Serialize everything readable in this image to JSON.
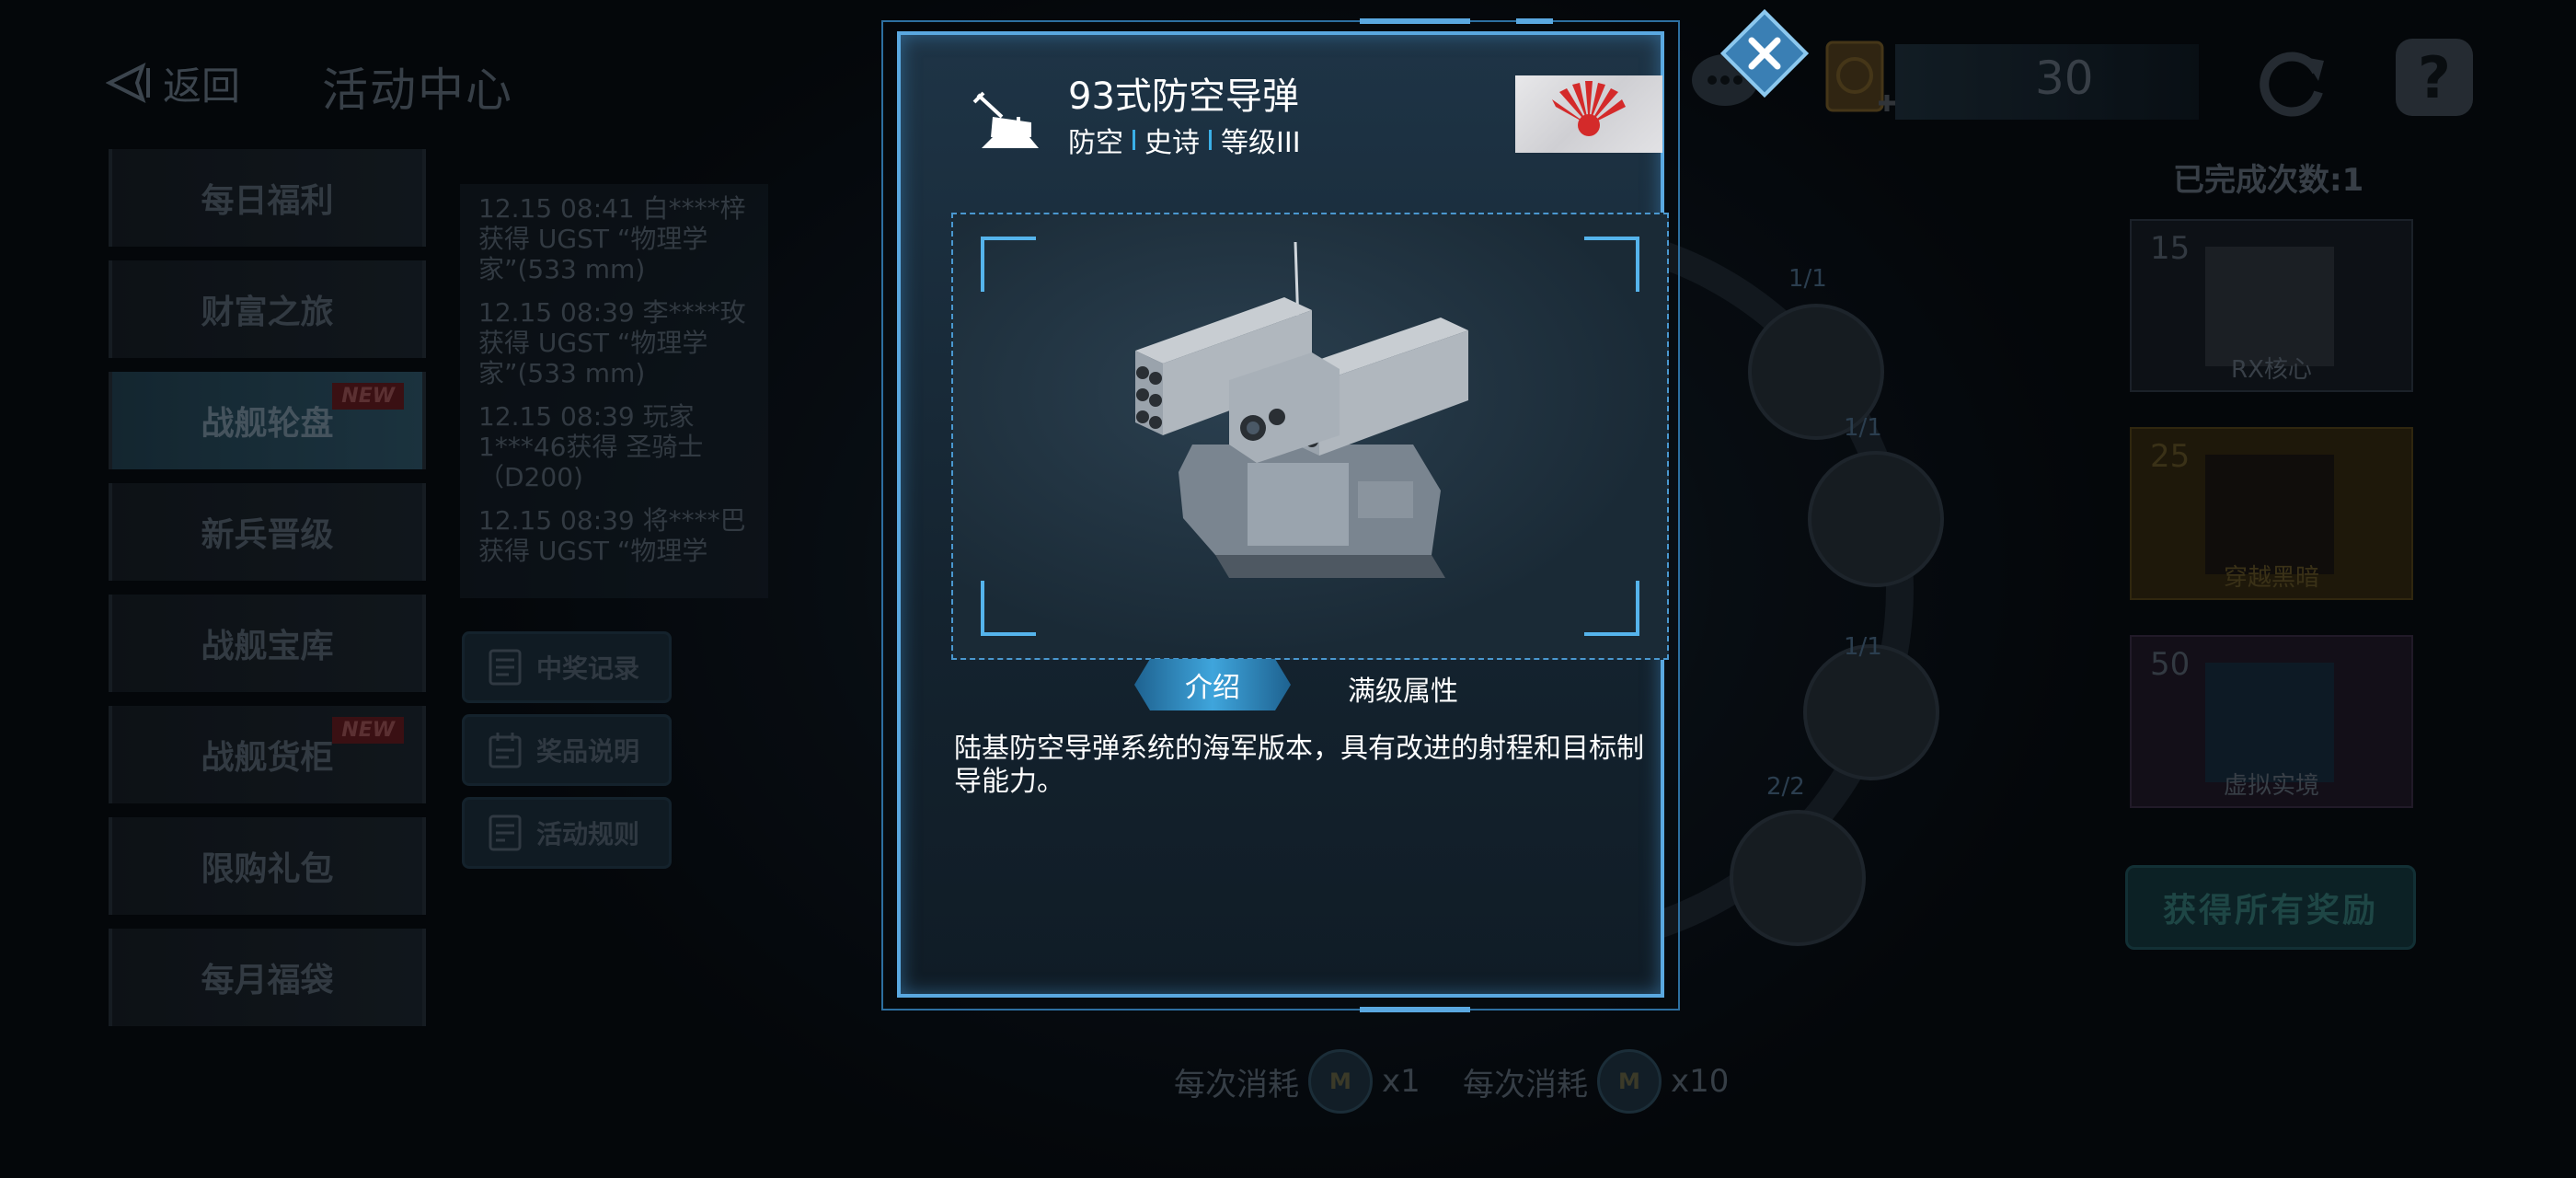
{
  "header": {
    "back_label": "返回",
    "title": "活动中心"
  },
  "menu": [
    {
      "label": "每日福利",
      "badge": ""
    },
    {
      "label": "财富之旅",
      "badge": ""
    },
    {
      "label": "战舰轮盘",
      "badge": "NEW"
    },
    {
      "label": "新兵晋级",
      "badge": ""
    },
    {
      "label": "战舰宝库",
      "badge": ""
    },
    {
      "label": "战舰货柜",
      "badge": "NEW"
    },
    {
      "label": "限购礼包",
      "badge": ""
    },
    {
      "label": "每月福袋",
      "badge": ""
    }
  ],
  "feed": [
    "12.15 08:41 白****梓获得 UGST “物理学家”(533 mm)",
    "12.15 08:39 李****玫获得 UGST “物理学家”(533 mm)",
    "12.15 08:39 玩家1***46获得 圣骑士（D200)",
    "12.15 08:39 将****巴获得 UGST “物理学"
  ],
  "side_buttons": [
    {
      "label": "中奖记录",
      "icon": "record-icon"
    },
    {
      "label": "奖品说明",
      "icon": "calendar-icon"
    },
    {
      "label": "活动规则",
      "icon": "rules-icon"
    }
  ],
  "currency": {
    "value": "30"
  },
  "completed": "已完成次数:1",
  "rewards": [
    {
      "num": "15",
      "name": "RX核心",
      "color": "#1a1f26"
    },
    {
      "num": "25",
      "name": "穿越黑暗",
      "color": "#3a2f12"
    },
    {
      "num": "50",
      "name": "虚拟实境",
      "color": "#221a2a"
    }
  ],
  "claim_all": "获得所有奖励",
  "wheel_counts": [
    "1/1",
    "1/1",
    "1/1",
    "2/2"
  ],
  "cost": [
    {
      "label": "每次消耗",
      "mult": "x1"
    },
    {
      "label": "每次消耗",
      "mult": "x10"
    }
  ],
  "modal": {
    "name": "93式防空导弹",
    "tags": [
      "防空",
      "史诗",
      "等级III"
    ],
    "tab_intro": "介绍",
    "tab_attr": "满级属性",
    "description": "陆基防空导弹系统的海军版本，具有改进的射程和目标制导能力。"
  },
  "colors": {
    "accent": "#5aa8e0",
    "tab": "#3fa5dc",
    "flag_red": "#d42a2a"
  }
}
